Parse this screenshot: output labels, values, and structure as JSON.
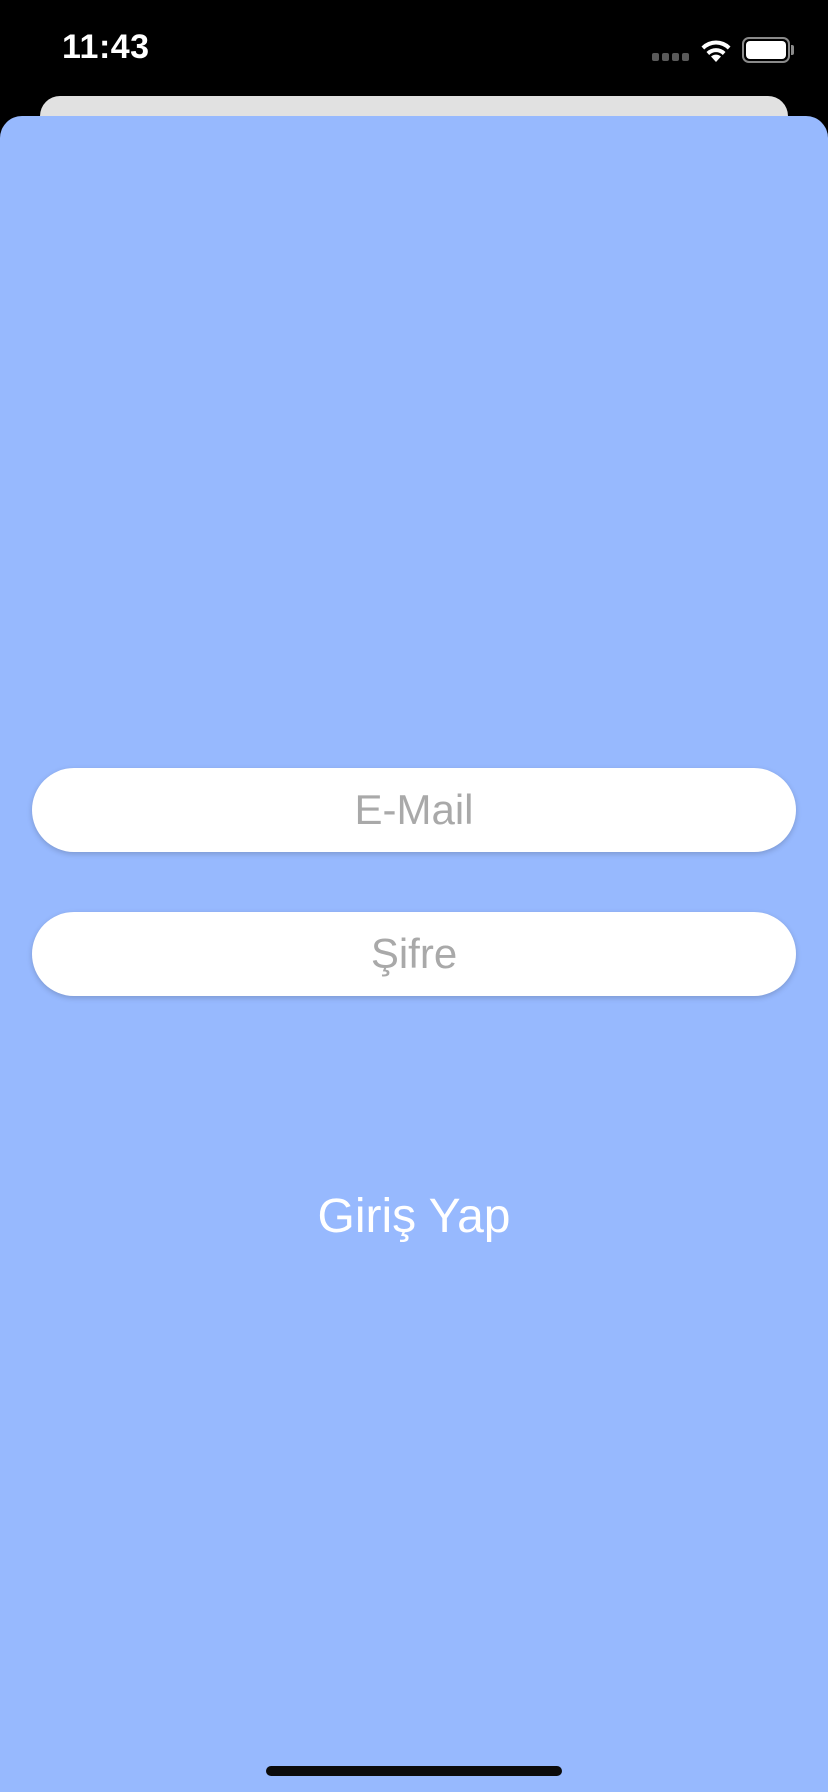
{
  "status_bar": {
    "time": "11:43"
  },
  "form": {
    "email_placeholder": "E-Mail",
    "password_placeholder": "Şifre",
    "login_label": "Giriş Yap"
  },
  "colors": {
    "background": "#97b9fe",
    "field_background": "#ffffff",
    "placeholder_text": "#a9a9a9",
    "button_text": "#ffffff"
  },
  "icons": {
    "signal": "cellular-signal-icon",
    "wifi": "wifi-icon",
    "battery": "battery-icon"
  }
}
